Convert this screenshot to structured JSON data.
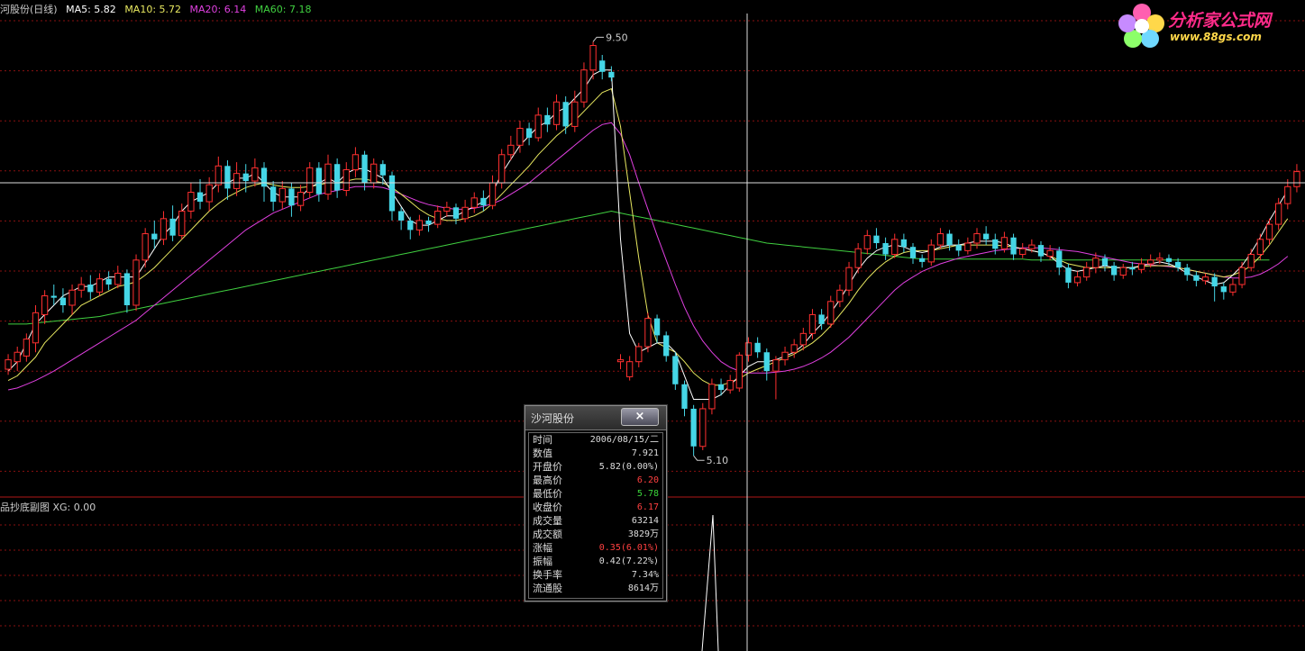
{
  "header": {
    "title": "河股份(日线)",
    "ma5": "MA5: 5.82",
    "ma10": "MA10: 5.72",
    "ma20": "MA20: 6.14",
    "ma60": "MA60: 7.18"
  },
  "sub_header": "品抄底副图 XG: 0.00",
  "logo": {
    "name": "分析家公式网",
    "url": "www.88gs.com"
  },
  "annotations": {
    "high": "9.50",
    "low": "5.10"
  },
  "popup": {
    "title": "沙河股份",
    "close_label": "×",
    "rows": [
      {
        "k": "时间",
        "v": "2006/08/15/二",
        "c": ""
      },
      {
        "k": "数值",
        "v": "7.921",
        "c": ""
      },
      {
        "k": "开盘价",
        "v": "5.82(0.00%)",
        "c": ""
      },
      {
        "k": "最高价",
        "v": "6.20",
        "c": "red"
      },
      {
        "k": "最低价",
        "v": "5.78",
        "c": "green"
      },
      {
        "k": "收盘价",
        "v": "6.17",
        "c": "red"
      },
      {
        "k": "成交量",
        "v": "63214",
        "c": ""
      },
      {
        "k": "成交额",
        "v": "3829万",
        "c": ""
      },
      {
        "k": "涨幅",
        "v": "0.35(6.01%)",
        "c": "red"
      },
      {
        "k": "振幅",
        "v": "0.42(7.22%)",
        "c": ""
      },
      {
        "k": "换手率",
        "v": "7.34%",
        "c": ""
      },
      {
        "k": "流通股",
        "v": "8614万",
        "c": ""
      }
    ]
  },
  "colors": {
    "up": "#ff3030",
    "down": "#45d6e6",
    "ma5": "#ffffff",
    "ma10": "#e8e860",
    "ma20": "#e040e0",
    "ma60": "#40d040",
    "grid": "#8a1010",
    "cross": "#dddddd"
  },
  "chart_data": {
    "type": "candlestick",
    "ylim": [
      4.7,
      9.8
    ],
    "y_shown": {
      "high": 9.5,
      "low": 5.1
    },
    "candles": [
      [
        6.02,
        6.12,
        6.18,
        5.96
      ],
      [
        6.1,
        6.2,
        6.26,
        6.0
      ],
      [
        6.16,
        6.34,
        6.4,
        6.1
      ],
      [
        6.3,
        6.62,
        6.7,
        6.2
      ],
      [
        6.6,
        6.8,
        6.86,
        6.5
      ],
      [
        6.8,
        6.78,
        6.92,
        6.7
      ],
      [
        6.78,
        6.7,
        6.88,
        6.62
      ],
      [
        6.7,
        6.86,
        6.92,
        6.6
      ],
      [
        6.86,
        6.92,
        7.0,
        6.78
      ],
      [
        6.92,
        6.84,
        7.02,
        6.76
      ],
      [
        6.84,
        6.98,
        7.04,
        6.8
      ],
      [
        6.98,
        6.92,
        7.06,
        6.86
      ],
      [
        6.92,
        7.04,
        7.12,
        6.88
      ],
      [
        7.04,
        6.7,
        7.08,
        6.62
      ],
      [
        6.7,
        7.18,
        7.24,
        6.64
      ],
      [
        7.18,
        7.46,
        7.52,
        7.1
      ],
      [
        7.46,
        7.4,
        7.6,
        7.3
      ],
      [
        7.4,
        7.62,
        7.7,
        7.34
      ],
      [
        7.62,
        7.44,
        7.76,
        7.38
      ],
      [
        7.44,
        7.7,
        7.78,
        7.4
      ],
      [
        7.7,
        7.9,
        8.0,
        7.62
      ],
      [
        7.9,
        7.8,
        8.04,
        7.72
      ],
      [
        7.8,
        7.98,
        8.06,
        7.7
      ],
      [
        7.98,
        8.18,
        8.28,
        7.9
      ],
      [
        8.18,
        7.94,
        8.24,
        7.82
      ],
      [
        7.94,
        8.1,
        8.22,
        7.86
      ],
      [
        8.1,
        8.02,
        8.2,
        7.9
      ],
      [
        8.02,
        8.16,
        8.26,
        7.96
      ],
      [
        8.16,
        7.96,
        8.22,
        7.8
      ],
      [
        7.96,
        7.8,
        8.02,
        7.7
      ],
      [
        7.8,
        7.94,
        8.02,
        7.72
      ],
      [
        7.94,
        7.76,
        8.0,
        7.64
      ],
      [
        7.76,
        7.9,
        7.98,
        7.7
      ],
      [
        7.9,
        8.16,
        8.22,
        7.84
      ],
      [
        8.16,
        7.88,
        8.22,
        7.8
      ],
      [
        7.88,
        8.2,
        8.3,
        7.82
      ],
      [
        8.2,
        7.92,
        8.26,
        7.84
      ],
      [
        7.92,
        8.14,
        8.22,
        7.86
      ],
      [
        8.14,
        8.3,
        8.38,
        8.06
      ],
      [
        8.3,
        8.0,
        8.34,
        7.92
      ],
      [
        8.0,
        8.2,
        8.26,
        7.94
      ],
      [
        8.2,
        8.08,
        8.24,
        7.98
      ],
      [
        8.08,
        7.7,
        8.12,
        7.6
      ],
      [
        7.7,
        7.6,
        7.74,
        7.5
      ],
      [
        7.6,
        7.5,
        7.64,
        7.4
      ],
      [
        7.5,
        7.6,
        7.66,
        7.44
      ],
      [
        7.6,
        7.56,
        7.64,
        7.48
      ],
      [
        7.56,
        7.7,
        7.76,
        7.52
      ],
      [
        7.7,
        7.74,
        7.8,
        7.64
      ],
      [
        7.74,
        7.62,
        7.78,
        7.56
      ],
      [
        7.62,
        7.74,
        7.82,
        7.58
      ],
      [
        7.74,
        7.84,
        7.9,
        7.68
      ],
      [
        7.84,
        7.76,
        7.92,
        7.7
      ],
      [
        7.76,
        8.0,
        8.08,
        7.72
      ],
      [
        8.0,
        8.3,
        8.36,
        7.94
      ],
      [
        8.3,
        8.4,
        8.5,
        8.24
      ],
      [
        8.4,
        8.58,
        8.66,
        8.32
      ],
      [
        8.58,
        8.48,
        8.64,
        8.4
      ],
      [
        8.48,
        8.72,
        8.8,
        8.44
      ],
      [
        8.72,
        8.62,
        8.8,
        8.54
      ],
      [
        8.62,
        8.86,
        8.94,
        8.56
      ],
      [
        8.86,
        8.6,
        8.92,
        8.52
      ],
      [
        8.6,
        8.86,
        8.98,
        8.54
      ],
      [
        8.86,
        9.2,
        9.28,
        8.8
      ],
      [
        9.2,
        9.46,
        9.5,
        9.1
      ],
      [
        9.3,
        9.18,
        9.36,
        9.1
      ],
      [
        9.18,
        9.12,
        9.24,
        9.08
      ],
      [
        6.1,
        6.12,
        6.18,
        6.02
      ],
      [
        5.94,
        6.1,
        6.16,
        5.9
      ],
      [
        6.1,
        6.26,
        6.3,
        6.04
      ],
      [
        6.26,
        6.56,
        6.62,
        6.2
      ],
      [
        6.56,
        6.38,
        6.6,
        6.3
      ],
      [
        6.38,
        6.16,
        6.42,
        6.1
      ],
      [
        6.16,
        5.86,
        6.2,
        5.8
      ],
      [
        5.86,
        5.6,
        5.9,
        5.52
      ],
      [
        5.6,
        5.2,
        5.64,
        5.1
      ],
      [
        5.2,
        5.6,
        5.66,
        5.16
      ],
      [
        5.6,
        5.86,
        5.92,
        5.54
      ],
      [
        5.86,
        5.8,
        5.92,
        5.74
      ],
      [
        5.8,
        5.9,
        5.96,
        5.76
      ],
      [
        5.82,
        6.17,
        6.2,
        5.78
      ],
      [
        6.17,
        6.3,
        6.36,
        6.1
      ],
      [
        6.3,
        6.2,
        6.36,
        6.14
      ],
      [
        6.2,
        6.0,
        6.24,
        5.9
      ],
      [
        6.0,
        6.12,
        6.16,
        5.7
      ],
      [
        6.12,
        6.2,
        6.26,
        6.06
      ],
      [
        6.2,
        6.28,
        6.34,
        6.14
      ],
      [
        6.28,
        6.4,
        6.46,
        6.22
      ],
      [
        6.4,
        6.6,
        6.66,
        6.34
      ],
      [
        6.6,
        6.5,
        6.66,
        6.44
      ],
      [
        6.5,
        6.74,
        6.8,
        6.46
      ],
      [
        6.74,
        6.86,
        6.92,
        6.68
      ],
      [
        6.86,
        7.1,
        7.16,
        6.8
      ],
      [
        7.1,
        7.3,
        7.36,
        7.04
      ],
      [
        7.3,
        7.44,
        7.5,
        7.24
      ],
      [
        7.44,
        7.36,
        7.52,
        7.3
      ],
      [
        7.36,
        7.24,
        7.42,
        7.18
      ],
      [
        7.24,
        7.4,
        7.46,
        7.2
      ],
      [
        7.4,
        7.32,
        7.46,
        7.26
      ],
      [
        7.32,
        7.2,
        7.36,
        7.14
      ],
      [
        7.2,
        7.16,
        7.24,
        7.1
      ],
      [
        7.16,
        7.34,
        7.4,
        7.12
      ],
      [
        7.34,
        7.46,
        7.52,
        7.3
      ],
      [
        7.46,
        7.34,
        7.5,
        7.28
      ],
      [
        7.34,
        7.28,
        7.4,
        7.22
      ],
      [
        7.28,
        7.36,
        7.42,
        7.24
      ],
      [
        7.36,
        7.46,
        7.52,
        7.3
      ],
      [
        7.46,
        7.4,
        7.54,
        7.34
      ],
      [
        7.4,
        7.3,
        7.46,
        7.24
      ],
      [
        7.3,
        7.42,
        7.48,
        7.26
      ],
      [
        7.42,
        7.24,
        7.46,
        7.18
      ],
      [
        7.24,
        7.3,
        7.36,
        7.2
      ],
      [
        7.3,
        7.34,
        7.4,
        7.26
      ],
      [
        7.34,
        7.22,
        7.38,
        7.16
      ],
      [
        7.22,
        7.28,
        7.34,
        7.18
      ],
      [
        7.28,
        7.1,
        7.32,
        7.02
      ],
      [
        7.1,
        6.94,
        7.14,
        6.88
      ],
      [
        6.94,
        7.0,
        7.06,
        6.9
      ],
      [
        7.0,
        7.1,
        7.16,
        6.96
      ],
      [
        7.1,
        7.2,
        7.26,
        7.04
      ],
      [
        7.2,
        7.12,
        7.24,
        7.06
      ],
      [
        7.12,
        7.02,
        7.16,
        6.96
      ],
      [
        7.02,
        7.1,
        7.14,
        6.98
      ],
      [
        7.1,
        7.08,
        7.16,
        7.02
      ],
      [
        7.08,
        7.14,
        7.2,
        7.04
      ],
      [
        7.14,
        7.18,
        7.24,
        7.1
      ],
      [
        7.18,
        7.2,
        7.26,
        7.14
      ],
      [
        7.2,
        7.16,
        7.24,
        7.12
      ],
      [
        7.16,
        7.1,
        7.2,
        7.06
      ],
      [
        7.1,
        7.02,
        7.14,
        6.96
      ],
      [
        7.02,
        6.96,
        7.06,
        6.9
      ],
      [
        6.96,
        7.0,
        7.04,
        6.92
      ],
      [
        7.0,
        6.9,
        7.04,
        6.74
      ],
      [
        6.9,
        6.84,
        6.94,
        6.76
      ],
      [
        6.84,
        6.92,
        6.98,
        6.8
      ],
      [
        6.92,
        7.1,
        7.16,
        6.88
      ],
      [
        7.1,
        7.24,
        7.3,
        7.06
      ],
      [
        7.24,
        7.4,
        7.46,
        7.18
      ],
      [
        7.4,
        7.56,
        7.62,
        7.34
      ],
      [
        7.56,
        7.78,
        7.84,
        7.5
      ],
      [
        7.78,
        7.96,
        8.04,
        7.72
      ],
      [
        7.96,
        8.12,
        8.2,
        7.9
      ]
    ],
    "ma5": [
      6.0,
      6.1,
      6.3,
      6.5,
      6.6,
      6.7,
      6.8,
      6.85,
      6.9,
      6.9,
      6.95,
      7.0,
      7.0,
      7.0,
      7.0,
      7.15,
      7.3,
      7.45,
      7.55,
      7.7,
      7.8,
      7.85,
      7.9,
      8.0,
      8.0,
      8.05,
      8.05,
      8.1,
      8.0,
      7.9,
      7.85,
      7.85,
      7.85,
      7.95,
      8.0,
      8.05,
      8.0,
      8.1,
      8.15,
      8.15,
      8.1,
      8.05,
      7.9,
      7.75,
      7.6,
      7.55,
      7.55,
      7.6,
      7.65,
      7.65,
      7.7,
      7.75,
      7.8,
      7.9,
      8.1,
      8.25,
      8.4,
      8.5,
      8.6,
      8.65,
      8.75,
      8.8,
      8.9,
      9.0,
      9.15,
      9.2,
      9.2,
      7.4,
      6.4,
      6.2,
      6.25,
      6.3,
      6.3,
      6.2,
      5.95,
      5.7,
      5.7,
      5.7,
      5.75,
      5.85,
      5.95,
      6.05,
      6.1,
      6.1,
      6.12,
      6.16,
      6.2,
      6.28,
      6.4,
      6.5,
      6.62,
      6.76,
      6.92,
      7.08,
      7.2,
      7.28,
      7.32,
      7.34,
      7.32,
      7.28,
      7.26,
      7.28,
      7.32,
      7.34,
      7.34,
      7.36,
      7.38,
      7.38,
      7.38,
      7.36,
      7.32,
      7.3,
      7.28,
      7.26,
      7.22,
      7.14,
      7.08,
      7.06,
      7.08,
      7.1,
      7.12,
      7.1,
      7.1,
      7.1,
      7.12,
      7.14,
      7.16,
      7.14,
      7.1,
      7.04,
      7.0,
      6.96,
      6.92,
      6.94,
      7.02,
      7.12,
      7.26,
      7.42,
      7.6,
      7.76,
      7.92
    ],
    "ma10": [
      5.9,
      5.95,
      6.05,
      6.15,
      6.3,
      6.4,
      6.5,
      6.6,
      6.7,
      6.75,
      6.8,
      6.85,
      6.9,
      6.92,
      6.95,
      7.02,
      7.1,
      7.2,
      7.3,
      7.4,
      7.5,
      7.6,
      7.7,
      7.78,
      7.85,
      7.9,
      7.95,
      7.98,
      8.0,
      7.98,
      7.96,
      7.95,
      7.95,
      7.96,
      7.98,
      8.0,
      8.0,
      8.02,
      8.04,
      8.04,
      8.02,
      8.0,
      7.95,
      7.88,
      7.8,
      7.72,
      7.66,
      7.62,
      7.6,
      7.6,
      7.62,
      7.65,
      7.7,
      7.78,
      7.88,
      7.98,
      8.08,
      8.18,
      8.3,
      8.4,
      8.5,
      8.58,
      8.66,
      8.76,
      8.86,
      8.96,
      9.0,
      8.6,
      7.9,
      7.2,
      6.6,
      6.3,
      6.25,
      6.2,
      6.1,
      5.98,
      5.9,
      5.85,
      5.85,
      5.88,
      5.92,
      5.98,
      6.02,
      6.06,
      6.1,
      6.14,
      6.18,
      6.24,
      6.3,
      6.38,
      6.48,
      6.6,
      6.72,
      6.86,
      6.98,
      7.08,
      7.16,
      7.22,
      7.26,
      7.28,
      7.28,
      7.28,
      7.3,
      7.32,
      7.34,
      7.34,
      7.34,
      7.34,
      7.34,
      7.33,
      7.32,
      7.3,
      7.28,
      7.26,
      7.22,
      7.18,
      7.14,
      7.12,
      7.1,
      7.1,
      7.1,
      7.1,
      7.1,
      7.1,
      7.11,
      7.12,
      7.12,
      7.12,
      7.1,
      7.08,
      7.06,
      7.04,
      7.02,
      7.0,
      7.02,
      7.06,
      7.12,
      7.22,
      7.34,
      7.48,
      7.62
    ],
    "ma20": [
      5.8,
      5.82,
      5.86,
      5.9,
      5.95,
      6.0,
      6.06,
      6.12,
      6.18,
      6.24,
      6.3,
      6.36,
      6.42,
      6.48,
      6.54,
      6.62,
      6.7,
      6.78,
      6.86,
      6.94,
      7.02,
      7.1,
      7.18,
      7.26,
      7.34,
      7.42,
      7.5,
      7.56,
      7.62,
      7.68,
      7.72,
      7.76,
      7.8,
      7.84,
      7.88,
      7.9,
      7.92,
      7.94,
      7.96,
      7.96,
      7.96,
      7.95,
      7.92,
      7.88,
      7.84,
      7.8,
      7.77,
      7.75,
      7.73,
      7.72,
      7.72,
      7.73,
      7.75,
      7.78,
      7.82,
      7.88,
      7.94,
      8.0,
      8.08,
      8.16,
      8.24,
      8.32,
      8.4,
      8.48,
      8.56,
      8.62,
      8.64,
      8.52,
      8.3,
      8.0,
      7.72,
      7.44,
      7.18,
      6.92,
      6.68,
      6.48,
      6.32,
      6.2,
      6.1,
      6.04,
      6.0,
      5.98,
      5.98,
      5.98,
      5.99,
      6.0,
      6.02,
      6.05,
      6.09,
      6.14,
      6.2,
      6.28,
      6.36,
      6.46,
      6.56,
      6.66,
      6.76,
      6.86,
      6.94,
      7.0,
      7.06,
      7.1,
      7.14,
      7.17,
      7.2,
      7.22,
      7.24,
      7.26,
      7.28,
      7.29,
      7.3,
      7.31,
      7.31,
      7.31,
      7.3,
      7.29,
      7.28,
      7.27,
      7.25,
      7.23,
      7.21,
      7.19,
      7.17,
      7.15,
      7.14,
      7.13,
      7.12,
      7.11,
      7.1,
      7.08,
      7.06,
      7.04,
      7.02,
      7.0,
      6.99,
      6.99,
      7.0,
      7.03,
      7.08,
      7.14,
      7.22
    ],
    "ma60": [
      6.5,
      6.5,
      6.5,
      6.51,
      6.52,
      6.53,
      6.54,
      6.55,
      6.56,
      6.57,
      6.58,
      6.6,
      6.62,
      6.64,
      6.66,
      6.68,
      6.7,
      6.72,
      6.74,
      6.76,
      6.78,
      6.8,
      6.82,
      6.84,
      6.86,
      6.88,
      6.9,
      6.92,
      6.94,
      6.96,
      6.98,
      7.0,
      7.02,
      7.04,
      7.06,
      7.08,
      7.1,
      7.12,
      7.14,
      7.16,
      7.18,
      7.2,
      7.22,
      7.24,
      7.26,
      7.28,
      7.3,
      7.32,
      7.34,
      7.36,
      7.38,
      7.4,
      7.42,
      7.44,
      7.46,
      7.48,
      7.5,
      7.52,
      7.54,
      7.56,
      7.58,
      7.6,
      7.62,
      7.64,
      7.66,
      7.68,
      7.7,
      7.68,
      7.66,
      7.64,
      7.62,
      7.6,
      7.58,
      7.56,
      7.54,
      7.52,
      7.5,
      7.48,
      7.46,
      7.44,
      7.42,
      7.4,
      7.38,
      7.36,
      7.35,
      7.34,
      7.33,
      7.32,
      7.31,
      7.3,
      7.29,
      7.28,
      7.27,
      7.26,
      7.25,
      7.24,
      7.23,
      7.22,
      7.21,
      7.2,
      7.19,
      7.19,
      7.19,
      7.19,
      7.19,
      7.19,
      7.19,
      7.19,
      7.19,
      7.19,
      7.19,
      7.19,
      7.18,
      7.18,
      7.18,
      7.18,
      7.18,
      7.18,
      7.18,
      7.18,
      7.18,
      7.18,
      7.18,
      7.18,
      7.18,
      7.18,
      7.18,
      7.18,
      7.18,
      7.18,
      7.18,
      7.18,
      7.18,
      7.18,
      7.18,
      7.18,
      7.18,
      7.18,
      7.18
    ]
  }
}
